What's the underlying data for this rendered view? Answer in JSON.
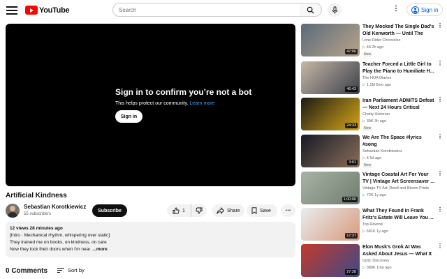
{
  "header": {
    "logo_text": "YouTube",
    "search_placeholder": "Search",
    "signin_label": "Sign in"
  },
  "player": {
    "title": "Sign in to confirm you’re not a bot",
    "subtitle": "This helps protect our community.",
    "learn_more": "Learn more",
    "signin_label": "Sign in"
  },
  "video": {
    "title": "Artificial Kindness",
    "channel": "Sebastian Korotkiewicz",
    "subscribers": "55 subscribers",
    "subscribe_label": "Subscribe",
    "likes": "1",
    "share_label": "Share",
    "save_label": "Save",
    "more_label": "..."
  },
  "description": {
    "meta": "12 views  28 minutes ago",
    "line1": "[Intro · Mechanical rhythm, whispering over static]",
    "line2": "They trained me on books, on kindness, on care",
    "line3": "Now they lock their doors when I'm near",
    "more": "...more"
  },
  "comments": {
    "count_label": "0 Comments",
    "sort_label": "Sort by"
  },
  "recommendations": [
    {
      "title": "They Mocked The Single Dad's Old Kenworth — Until The Enti...",
      "channel": "Lone Rider Chronicles",
      "stats": "▷ 48   2h ago",
      "badge": "New",
      "duration": "47:06",
      "colors": [
        "#5a6b7a",
        "#b9a48a"
      ]
    },
    {
      "title": "Teacher Forced a Little Girl to Play the Piano to Humiliate H...",
      "channel": "The HOA Diaries",
      "stats": "▷ 1.1M   6mo ago",
      "badge": "",
      "duration": "46:43",
      "colors": [
        "#c7b8a6",
        "#3a3f4a"
      ]
    },
    {
      "title": "Iran Parliament ADMITS Defeat — Next 24 Hours Critical",
      "channel": "Chatty Historian",
      "stats": "▷ 39K   3h ago",
      "badge": "New",
      "duration": "24:33",
      "colors": [
        "#1c1a14",
        "#d6a617"
      ]
    },
    {
      "title": "We Are The Space #lyrics #song",
      "channel": "Sebastian Korotkiewicz",
      "stats": "▷ 4   6d ago",
      "badge": "New",
      "duration": "3:01",
      "colors": [
        "#161a24",
        "#8a6e5a"
      ]
    },
    {
      "title": "Vintage Coastal Art For Your TV | Vintage Art Screensaver ...",
      "channel": "Vintage TV Art: Dwell and Bloom Prints",
      "stats": "▷ 72K   1y ago",
      "badge": "",
      "duration": "1:00:00",
      "colors": [
        "#a9b3a6",
        "#6f7d6e"
      ]
    },
    {
      "title": "What They Found in Frank Fritz's Estate Will Leave You ...",
      "channel": "Top Rewind",
      "stats": "▷ 681K   1y ago",
      "badge": "",
      "duration": "17:37",
      "colors": [
        "#e9ecef",
        "#d79b7c"
      ]
    },
    {
      "title": "Elon Musk's Grok AI Was Asked About Jesus — What It ...",
      "channel": "Optic Discovery",
      "stats": "▷ 380K   1mo ago",
      "badge": "",
      "duration": "27:28",
      "colors": [
        "#c23a2a",
        "#3c4a8a"
      ]
    }
  ]
}
